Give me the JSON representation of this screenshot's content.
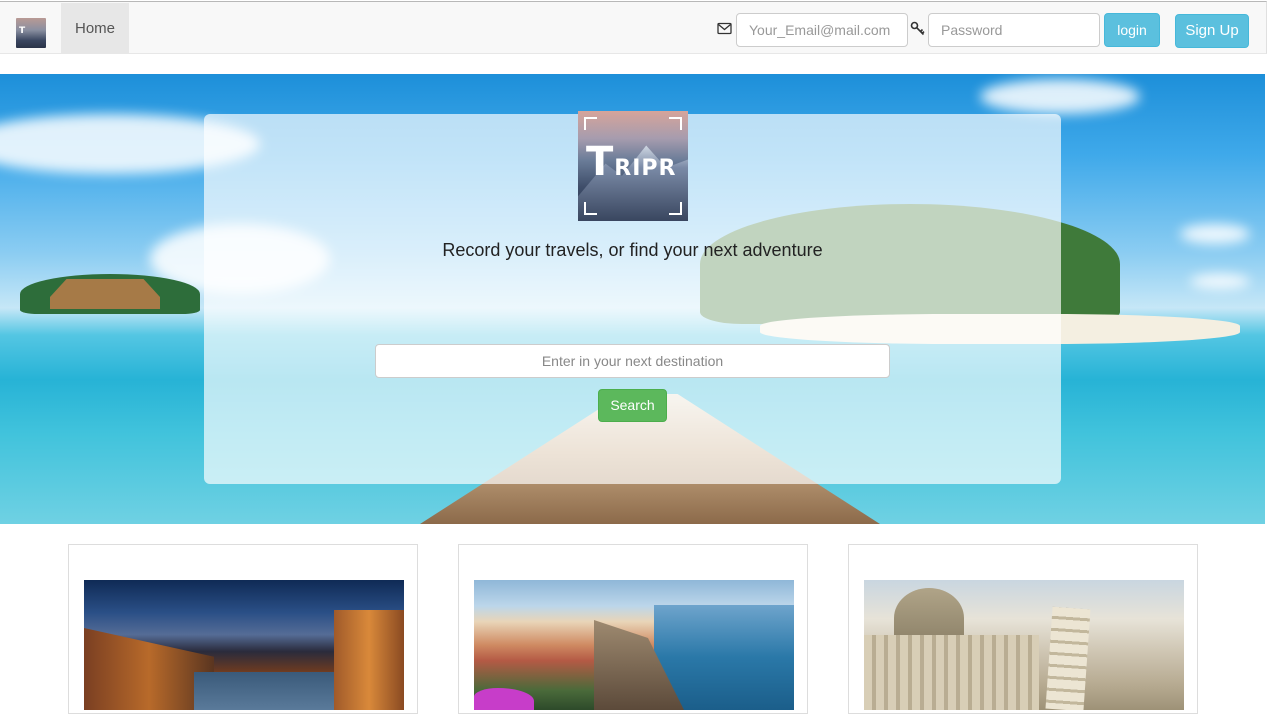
{
  "navbar": {
    "brand_icon": "tripr-logo",
    "home_label": "Home",
    "mail_icon": "envelope-icon",
    "key_icon": "key-icon",
    "email_placeholder": "Your_Email@mail.com",
    "password_placeholder": "Password",
    "login_label": "login",
    "signup_label": "Sign Up"
  },
  "hero": {
    "logo_text_big": "T",
    "logo_text_small": "RIPR",
    "tagline": "Record your travels, or find your next adventure",
    "search_placeholder": "Enter in your next destination",
    "search_label": "Search"
  },
  "cards": [
    {
      "image": "venice-canal-photo"
    },
    {
      "image": "cinque-terre-photo"
    },
    {
      "image": "pisa-tower-photo"
    }
  ],
  "colors": {
    "info": "#5bc0de",
    "success": "#5cb85c",
    "navbar_bg": "#f8f8f8",
    "home_active_bg": "#e7e7e7"
  }
}
